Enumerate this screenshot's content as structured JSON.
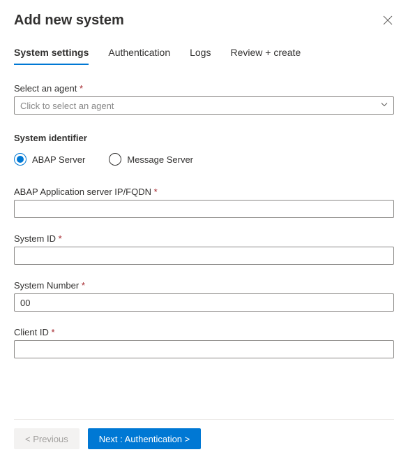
{
  "header": {
    "title": "Add new system"
  },
  "tabs": [
    {
      "label": "System settings",
      "active": true
    },
    {
      "label": "Authentication",
      "active": false
    },
    {
      "label": "Logs",
      "active": false
    },
    {
      "label": "Review + create",
      "active": false
    }
  ],
  "agent": {
    "label": "Select an agent",
    "placeholder": "Click to select an agent",
    "value": ""
  },
  "system_identifier": {
    "title": "System identifier",
    "options": [
      {
        "label": "ABAP Server",
        "selected": true
      },
      {
        "label": "Message Server",
        "selected": false
      }
    ]
  },
  "fields": {
    "abap_server": {
      "label": "ABAP Application server IP/FQDN",
      "value": ""
    },
    "system_id": {
      "label": "System ID",
      "value": ""
    },
    "system_number": {
      "label": "System Number",
      "value": "00"
    },
    "client_id": {
      "label": "Client ID",
      "value": ""
    }
  },
  "footer": {
    "previous": "< Previous",
    "next": "Next : Authentication  >"
  }
}
